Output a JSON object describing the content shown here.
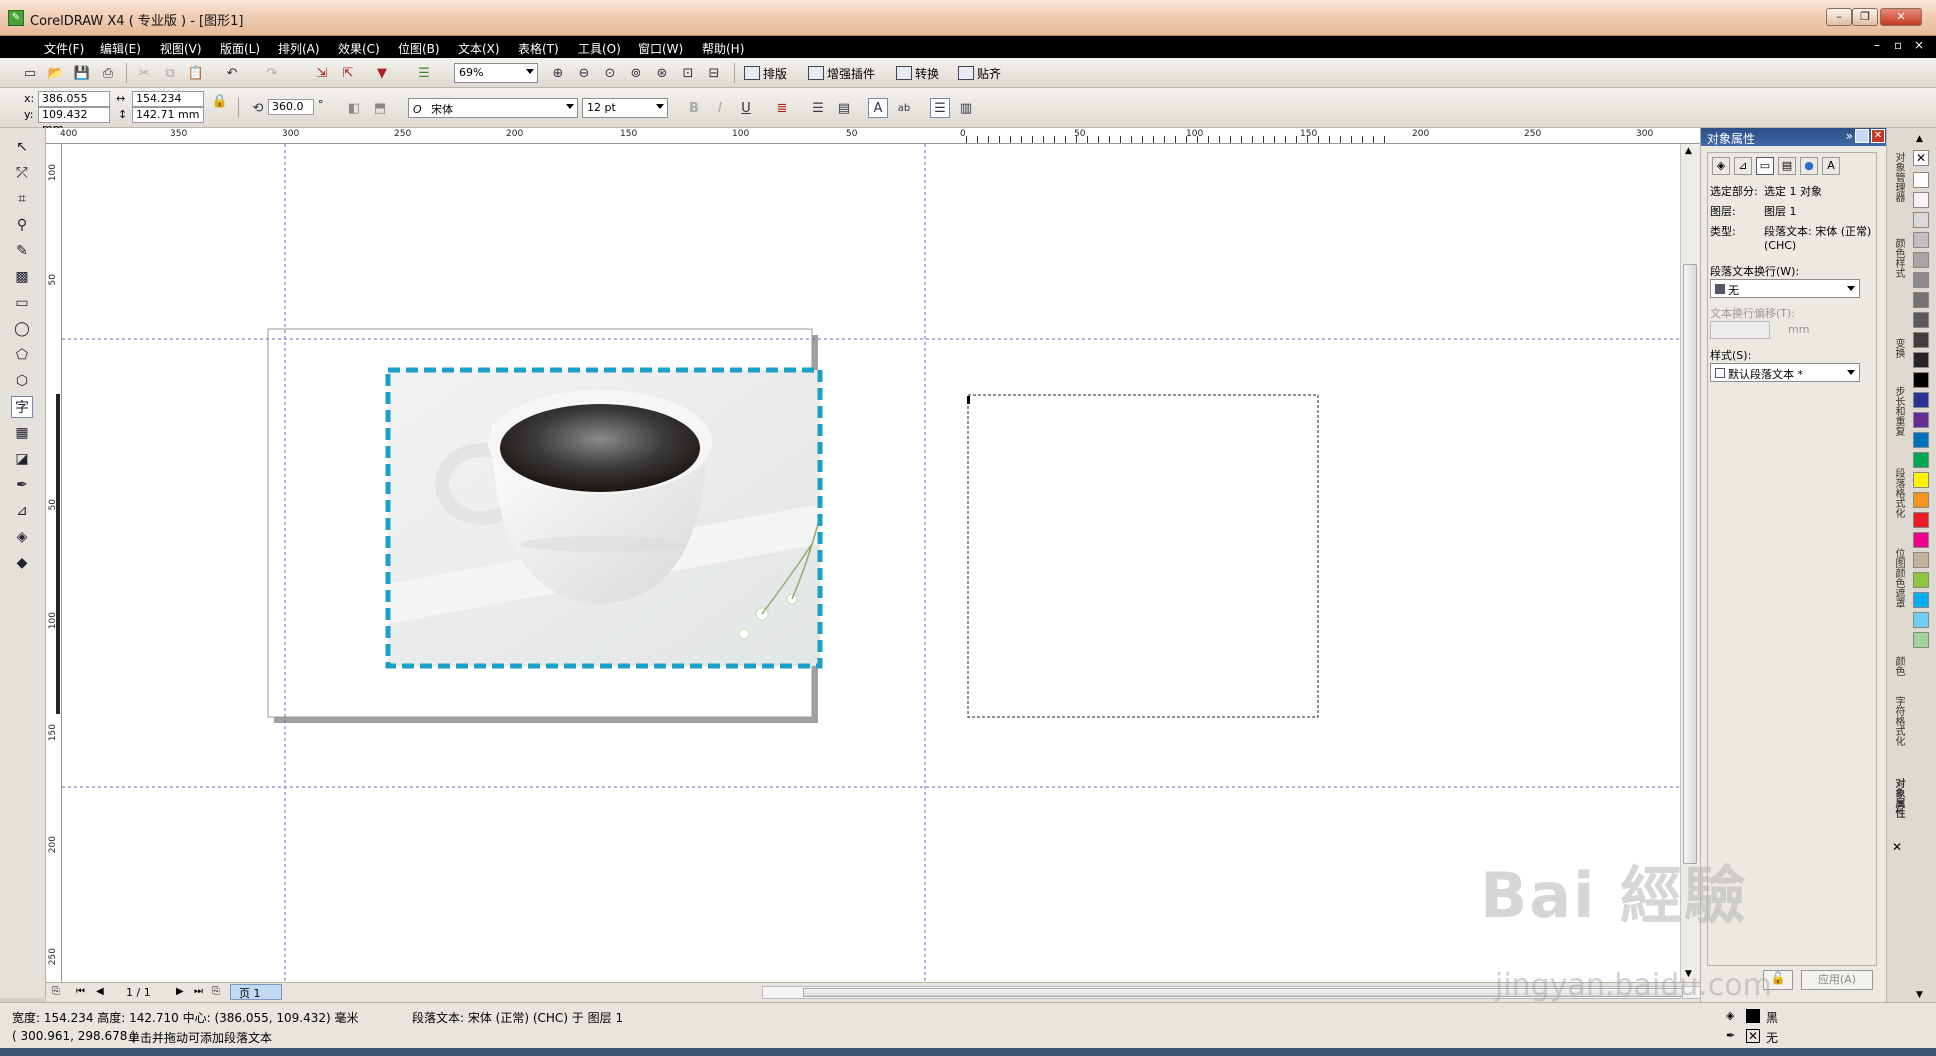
{
  "window": {
    "title": "CorelDRAW X4 ( 专业版 ) - [图形1]",
    "app_icon": "coreldraw-icon"
  },
  "menubar": {
    "items": [
      "文件(F)",
      "编辑(E)",
      "视图(V)",
      "版面(L)",
      "排列(A)",
      "效果(C)",
      "位图(B)",
      "文本(X)",
      "表格(T)",
      "工具(O)",
      "窗口(W)",
      "帮助(H)"
    ]
  },
  "toolbar": {
    "zoom": "69%",
    "btn_layout": "排版",
    "btn_plugin": "增强插件",
    "btn_convert": "转换",
    "btn_snap": "贴齐"
  },
  "propbar": {
    "x_label": "x:",
    "x_value": "386.055 mm",
    "y_label": "y:",
    "y_value": "109.432 mm",
    "width_value": "154.234 mm",
    "height_value": "142.71 mm",
    "rotation": "360.0",
    "rotation_unit": "°",
    "font_name": "宋体",
    "font_size": "12 pt"
  },
  "ruler_h": [
    "400",
    "350",
    "300",
    "250",
    "200",
    "150",
    "100",
    "50",
    "0",
    "50",
    "100",
    "150",
    "200",
    "250",
    "300",
    "350"
  ],
  "ruler_v": [
    "100",
    "50",
    "0",
    "50",
    "100",
    "150",
    "200",
    "250"
  ],
  "pagebar": {
    "counter": "1 / 1",
    "page_tab": "页 1"
  },
  "status": {
    "dimensions": "宽度: 154.234  高度: 142.710  中心: (386.055, 109.432)  毫米",
    "object_info": "段落文本: 宋体 (正常) (CHC) 于 图层 1",
    "cursor_pos": "( 300.961, 298.678 )",
    "hint": "单击并拖动可添加段落文本",
    "fill_label": "黑",
    "outline_label": "无"
  },
  "docker": {
    "title": "对象属性",
    "selection_label": "选定部分:",
    "selection_value": "选定 1 对象",
    "layer_label": "图层:",
    "layer_value": "图层 1",
    "type_label": "类型:",
    "type_value": "段落文本: 宋体 (正常) (CHC)",
    "wrap_label": "段落文本换行(W):",
    "wrap_value": "无",
    "offset_label": "文本换行偏移(T):",
    "offset_unit": "mm",
    "style_label": "样式(S):",
    "style_value": "默认段落文本 *",
    "apply_button": "应用(A)"
  },
  "vertical_tabs": [
    "对象管理器",
    "颜色样式",
    "变换",
    "步长和重复",
    "段落格式化",
    "位图颜色遮罩",
    "颜色",
    "字符格式化",
    "对象属性"
  ],
  "palette_colors": [
    "#ffffff",
    "#f2f2f2",
    "#d9d9d9",
    "#bfbfbf",
    "#a6a6a6",
    "#8c8c8c",
    "#737373",
    "#595959",
    "#404040",
    "#262626",
    "#000000",
    "#2e3192",
    "#662d91",
    "#0072bc",
    "#00a651",
    "#fff200",
    "#f7941d",
    "#ed1c24",
    "#ec008c",
    "#c7b299",
    "#8dc63f",
    "#00aeef",
    "#6dcff6",
    "#a3d39c"
  ],
  "watermark": {
    "main": "Bai 經驗",
    "sub": "jingyan.baidu.com"
  }
}
